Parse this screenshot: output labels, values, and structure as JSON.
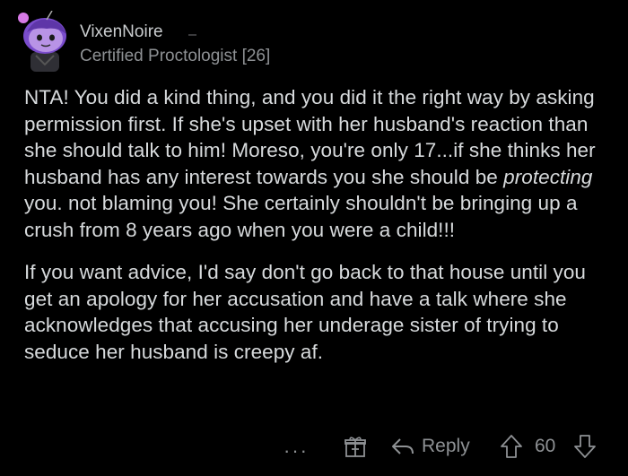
{
  "author": {
    "username": "VixenNoire",
    "flair": "Certified Proctologist [26]",
    "avatar_icon": "snoo-avatar-icon"
  },
  "comment": {
    "p1_before": "NTA!  You did a kind thing, and you did it the right way by asking permission first.  If she's upset with her husband's reaction than she should talk to him!  Moreso, you're only 17...if she thinks her husband has any interest towards you she should be ",
    "p1_emph": "protecting",
    "p1_after": " you.  not blaming you!  She certainly shouldn't be bringing up a crush from 8 years ago when you were a child!!!",
    "p2": "If you want advice, I'd say don't go back to that house until you get an apology for her accusation and have a talk where she acknowledges that accusing her underage sister of trying to seduce her husband is creepy af."
  },
  "actions": {
    "more": "···",
    "award_icon": "award-gift-icon",
    "reply_label": "Reply",
    "score": "60"
  },
  "colors": {
    "background": "#000000",
    "text": "#d7dadc",
    "muted": "#8e9194",
    "avatar_skin": "#b893e6",
    "avatar_hair": "#8c5ad8"
  }
}
